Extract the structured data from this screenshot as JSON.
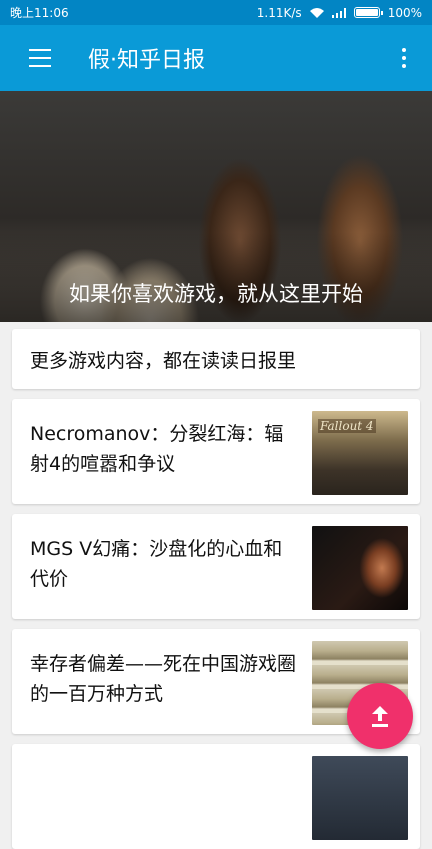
{
  "status_bar": {
    "time": "晚上11:06",
    "network_speed": "1.11K/s",
    "battery": "100%",
    "icons": [
      "wifi-icon",
      "signal-icon",
      "battery-icon"
    ]
  },
  "toolbar": {
    "menu_icon": "menu-icon",
    "title": "假·知乎日报",
    "more_icon": "more-vert-icon"
  },
  "hero": {
    "caption": "如果你喜欢游戏，就从这里开始"
  },
  "banner": {
    "text": "更多游戏内容，都在读读日报里"
  },
  "stories": [
    {
      "title": "Necromanov：分裂红海：辐射4的喧嚣和争议",
      "thumb_label": "Fallout 4"
    },
    {
      "title": "MGS V幻痛：沙盘化的心血和代价"
    },
    {
      "title": "幸存者偏差——死在中国游戏圈的一百万种方式"
    }
  ],
  "fab": {
    "icon": "arrow-up-icon"
  },
  "colors": {
    "toolbar": "#0a9ad7",
    "status_bar": "#0285c4",
    "fab": "#f0306b",
    "background": "#f0f0f0"
  }
}
